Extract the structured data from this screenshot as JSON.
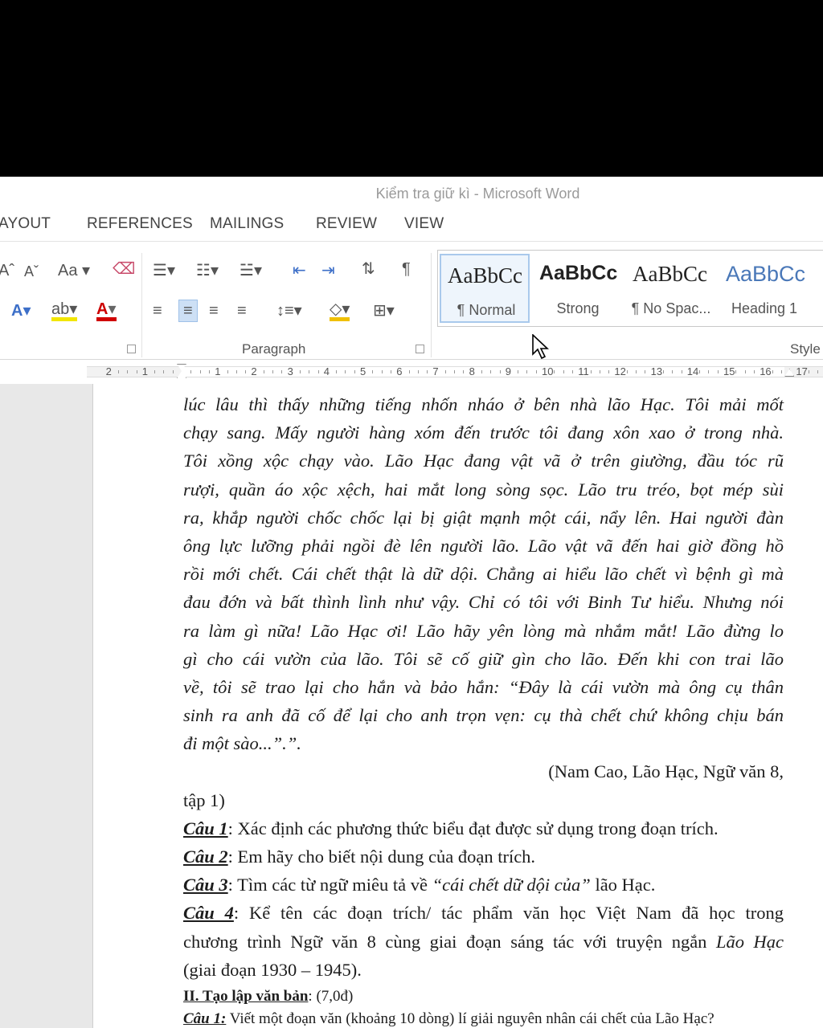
{
  "window": {
    "title": "Kiểm tra giữ kì - Microsoft Word"
  },
  "tabs": [
    "AYOUT",
    "REFERENCES",
    "MAILINGS",
    "REVIEW",
    "VIEW"
  ],
  "ribbon": {
    "font_case_label": "Aa",
    "paragraph_group_label": "Paragraph",
    "styles_group_label": "Style",
    "styles": [
      {
        "sample": "AaBbCc",
        "name": "¶ Normal",
        "selected": true
      },
      {
        "sample": "AaBbCc",
        "name": "Strong",
        "selected": false
      },
      {
        "sample": "AaBbCc",
        "name": "¶ No Spac...",
        "selected": false
      },
      {
        "sample": "AaBbCc",
        "name": "Heading 1",
        "selected": false
      }
    ]
  },
  "ruler": {
    "numbers": [
      "2",
      "1",
      "1",
      "2",
      "3",
      "4",
      "5",
      "6",
      "7",
      "8",
      "9",
      "10",
      "11",
      "12",
      "13",
      "14",
      "15",
      "16",
      "17"
    ]
  },
  "document": {
    "excerpt_lines": [
      "lúc lâu thì thấy những tiếng nhốn nháo ở bên nhà lão Hạc. Tôi mải mốt",
      "chạy sang. Mấy người hàng xóm đến trước tôi đang xôn xao ở trong nhà.",
      "Tôi xồng xộc chạy vào. Lão Hạc đang vật vã ở trên giường, đầu tóc rũ",
      "rượi, quần áo xộc xệch, hai mắt long sòng sọc. Lão tru tréo, bọt mép sùi",
      "ra, khắp người chốc chốc lại bị giật mạnh một cái, nẩy lên. Hai người đàn",
      "ông lực lưỡng phải ngồi đè lên người lão. Lão vật vã đến hai giờ đồng hồ",
      "rồi mới chết. Cái chết thật là dữ dội. Chẳng ai hiểu lão chết vì bệnh gì mà",
      "đau đớn và bất thình lình như vậy. Chỉ có tôi với Binh Tư hiểu. Nhưng nói",
      "ra làm gì nữa! Lão Hạc ơi! Lão hãy yên lòng mà nhắm mắt! Lão đừng lo",
      "gì cho cái vườn của lão. Tôi sẽ cố giữ gìn cho lão. Đến khi con trai lão",
      "về, tôi sẽ trao lại cho hắn và bảo hắn: “Đây là cái vườn mà ông cụ thân",
      "sinh ra anh đã cố để lại cho anh trọn vẹn: cụ thà chết chứ không chịu bán",
      "đi một sào...”.”."
    ],
    "citation_line1": "(Nam Cao, Lão Hạc, Ngữ văn 8,",
    "citation_line2": "tập 1)",
    "q1_label": "Câu 1",
    "q1_text": ": Xác định các phương thức biểu đạt được sử dụng trong đoạn trích.",
    "q2_label": "Câu 2",
    "q2_text": ": Em hãy cho biết nội dung của đoạn trích.",
    "q3_label": "Câu 3",
    "q3_text_a": ": Tìm các từ ngữ miêu tả về ",
    "q3_quote": "“cái chết dữ dội của”",
    "q3_text_b": " lão Hạc.",
    "q4_label": "Câu 4",
    "q4_text_1": ": Kể tên các đoạn trích/ tác phẩm văn học Việt Nam đã học trong",
    "q4_text_2a": "chương trình Ngữ văn 8 cùng giai đoạn sáng tác với truyện ngắn ",
    "q4_text_2b": "Lão Hạc",
    "q4_text_3": "(giai đoạn 1930 – 1945).",
    "section2_label": "II. Tạo lập văn bản",
    "section2_score": ": (7,0đ)",
    "s2q1_label": "Câu 1:",
    "s2q1_text": " Viết một đoạn văn (khoảng 10 dòng) lí giải nguyên nhân cái chết của Lão Hạc?"
  }
}
